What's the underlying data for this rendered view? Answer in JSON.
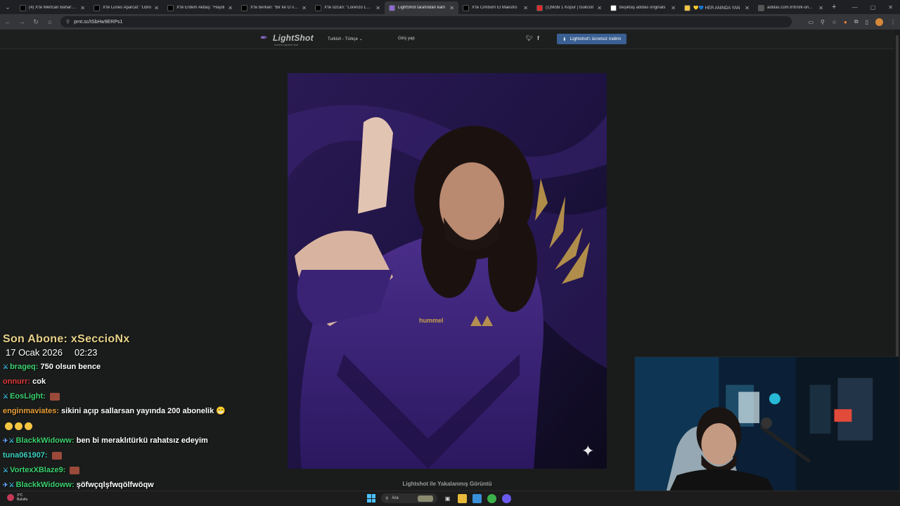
{
  "browser": {
    "tabs": [
      {
        "title": "(4) X'te Mertcan Bahar: \"Ja",
        "active": false,
        "favicon": "x-icon"
      },
      {
        "title": "X'te Lunes Aparcat: \"Libro",
        "active": false,
        "favicon": "x-icon"
      },
      {
        "title": "X'te Erdem Akbaş: \"Haydi",
        "active": false,
        "favicon": "x-icon"
      },
      {
        "title": "X'te berkan: \"Bir ke Ö ver\"",
        "active": false,
        "favicon": "x-icon"
      },
      {
        "title": "X'te ozcan: \"Lorenzo Luca",
        "active": false,
        "favicon": "x-icon"
      },
      {
        "title": "LightShot tarafından kam",
        "active": true,
        "favicon": "lightshot-icon"
      },
      {
        "title": "X'te Cimbom El Maestro",
        "active": false,
        "favicon": "x-icon"
      },
      {
        "title": "(1)Mobi 1 Kopur | tsokcoll",
        "active": false,
        "favicon": "youtube-icon"
      },
      {
        "title": "beşiktaş adidas originals",
        "active": false,
        "favicon": "google-icon"
      },
      {
        "title": "💛💙 HER ANINDA YAN",
        "active": false,
        "favicon": "heart-icon"
      },
      {
        "title": "adidas.com.tr/tr/sfk-on...",
        "active": false,
        "favicon": "globe-icon"
      }
    ],
    "url": "prnt.sc/tSbHw9ERPs1"
  },
  "lightshot": {
    "logo_name": "LightShot",
    "logo_tag": "screen capture tool",
    "language": "Turkish - Türkçe",
    "login": "Giriş yap",
    "download_label": "Lightshot'ı ücretsiz indirin",
    "caption": "Lightshot ile Yakalanmış Görüntü"
  },
  "stream": {
    "sub_title": "Son Abone: xSeccioNx",
    "sub_date": "17 Ocak 2026",
    "sub_time": "02:23"
  },
  "chat": [
    {
      "user": "brageq:",
      "text": "750 olsun bence",
      "color": "#3bd16f",
      "badge": "sword"
    },
    {
      "user": "onnurr:",
      "text": "cok",
      "color": "#e03a3a",
      "badge": ""
    },
    {
      "user": "EosLight:",
      "text": "",
      "color": "#3bd16f",
      "badge": "sword",
      "emote": true
    },
    {
      "user": "enginmaviates:",
      "text": "sikini açıp sallarsan yayında 200 abonelik 😁",
      "color": "#e8a03a",
      "badge": ""
    },
    {
      "user": "",
      "text": "",
      "color": "#fff",
      "badge": "",
      "emojis": 3
    },
    {
      "user": "BlackkWidoww:",
      "text": "ben bi meraklıtürkü rahatsız edeyim",
      "color": "#3bd16f",
      "badge": "double"
    },
    {
      "user": "tuna061907:",
      "text": "",
      "color": "#3bd1c0",
      "badge": "",
      "emote": true
    },
    {
      "user": "VortexXBlaze9:",
      "text": "",
      "color": "#3bd16f",
      "badge": "sword",
      "emote": true
    },
    {
      "user": "BlackkWidoww:",
      "text": "şöfwçqlşfwqölfwöqw",
      "color": "#3bd16f",
      "badge": "double"
    }
  ],
  "taskbar": {
    "weather_temp": "3°C",
    "weather_desc": "Bulutlu",
    "search_placeholder": "Ara"
  },
  "colors": {
    "accent": "#3a5f93",
    "chat_green": "#3bd16f",
    "subscriber_gold": "#e8d28a"
  }
}
